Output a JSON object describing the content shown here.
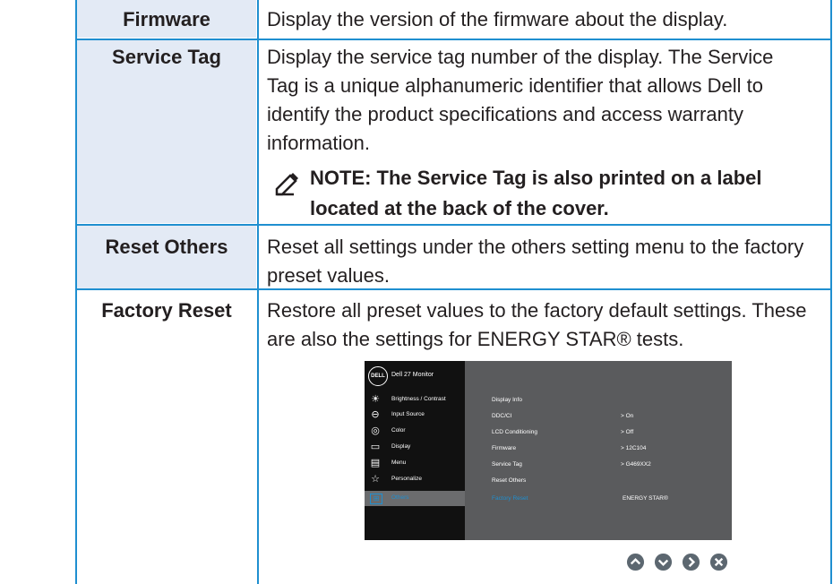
{
  "rows": [
    {
      "term": "Firmware",
      "description": "Display the version of the firmware about the display."
    },
    {
      "term": "Service Tag",
      "description": "Display the service tag number of the display. The Service Tag is a unique alphanumeric identifier that allows Dell to identify the product specifications and access warranty information.",
      "note": "NOTE: The Service Tag is also printed on a label located at the back of the cover."
    },
    {
      "term": "Reset Others",
      "description": "Reset all settings under the others setting menu to the factory preset values."
    },
    {
      "term": "Factory Reset",
      "description": "Restore all preset values to the factory default settings. These are also the settings for ENERGY STAR® tests."
    }
  ],
  "osd": {
    "logo": "DELL",
    "title": "Dell 27 Monitor",
    "menu": [
      {
        "label": "Brightness / Contrast",
        "icon": "brightness-icon"
      },
      {
        "label": "Input Source",
        "icon": "input-source-icon"
      },
      {
        "label": "Color",
        "icon": "color-icon"
      },
      {
        "label": "Display",
        "icon": "display-icon"
      },
      {
        "label": "Menu",
        "icon": "menu-icon"
      },
      {
        "label": "Personalize",
        "icon": "star-icon"
      },
      {
        "label": "Others",
        "icon": "others-icon"
      }
    ],
    "settings": [
      {
        "key": "Display Info",
        "value": ""
      },
      {
        "key": "DDC/CI",
        "value": ">   On"
      },
      {
        "key": "LCD Conditioning",
        "value": ">   Off"
      },
      {
        "key": "Firmware",
        "value": ">   12C104"
      },
      {
        "key": "Service Tag",
        "value": ">   G469XX2"
      },
      {
        "key": "Reset Others",
        "value": ""
      },
      {
        "key": "Factory Reset",
        "value": "ENERGY STAR®"
      }
    ],
    "nav_buttons": [
      "up-arrow-icon",
      "down-arrow-icon",
      "right-arrow-icon",
      "close-icon"
    ]
  },
  "colors": {
    "border": "#1f8fd0",
    "cell_bg": "#e3eaf5",
    "accent": "#1f8fd0"
  }
}
